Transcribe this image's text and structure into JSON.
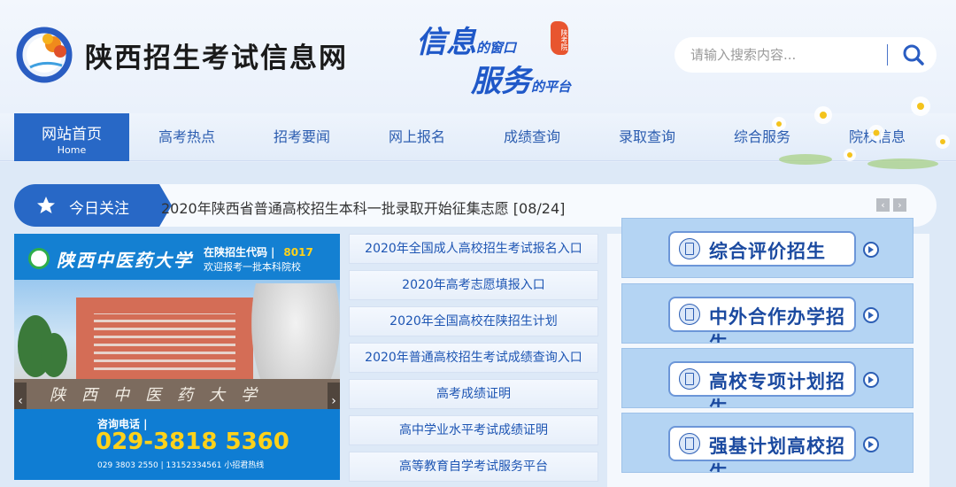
{
  "header": {
    "site_title": "陕西招生考试信息网",
    "slogan": {
      "line1_big": "信息",
      "line1_small": "的窗口",
      "line2_big": "服务",
      "line2_small": "的平台",
      "stamp": "陕考院"
    },
    "search": {
      "placeholder": "请输入搜索内容...",
      "icon": "search-icon"
    }
  },
  "nav": {
    "items": [
      {
        "label": "网站首页",
        "sub": "Home",
        "active": true
      },
      {
        "label": "高考热点"
      },
      {
        "label": "招考要闻"
      },
      {
        "label": "网上报名"
      },
      {
        "label": "成绩查询"
      },
      {
        "label": "录取查询"
      },
      {
        "label": "综合服务"
      },
      {
        "label": "院校信息"
      }
    ]
  },
  "today": {
    "label": "今日关注",
    "headline": "2020年陕西省普通高校招生本科一批录取开始征集志愿  [08/24]",
    "prev": "‹",
    "next": "›"
  },
  "banner": {
    "university": "陕西中医药大学",
    "code_label": "在陕招生代码",
    "code_sep": "|",
    "code": "8017",
    "welcome": "欢迎报考一批本科院校",
    "wall_text": "陕西中医药大学",
    "phone_label": "咨询电话 |",
    "phone": "029-3818 5360",
    "phone_extra": "029 3803 2550  |  13152334561 小招君热线",
    "prev": "‹",
    "next": "›"
  },
  "quick_links": [
    "2020年全国成人高校招生考试报名入口",
    "2020年高考志愿填报入口",
    "2020年全国高校在陕招生计划",
    "2020年普通高校招生考试成绩查询入口",
    "高考成绩证明",
    "高中学业水平考试成绩证明",
    "高等教育自学考试服务平台"
  ],
  "special": [
    {
      "label": "综合评价招生"
    },
    {
      "label": "中外合作办学招生"
    },
    {
      "label": "高校专项计划招生"
    },
    {
      "label": "强基计划高校招生"
    }
  ],
  "colors": {
    "primary": "#2868c6",
    "link": "#1d55b3",
    "accent_yellow": "#ffd21a"
  }
}
